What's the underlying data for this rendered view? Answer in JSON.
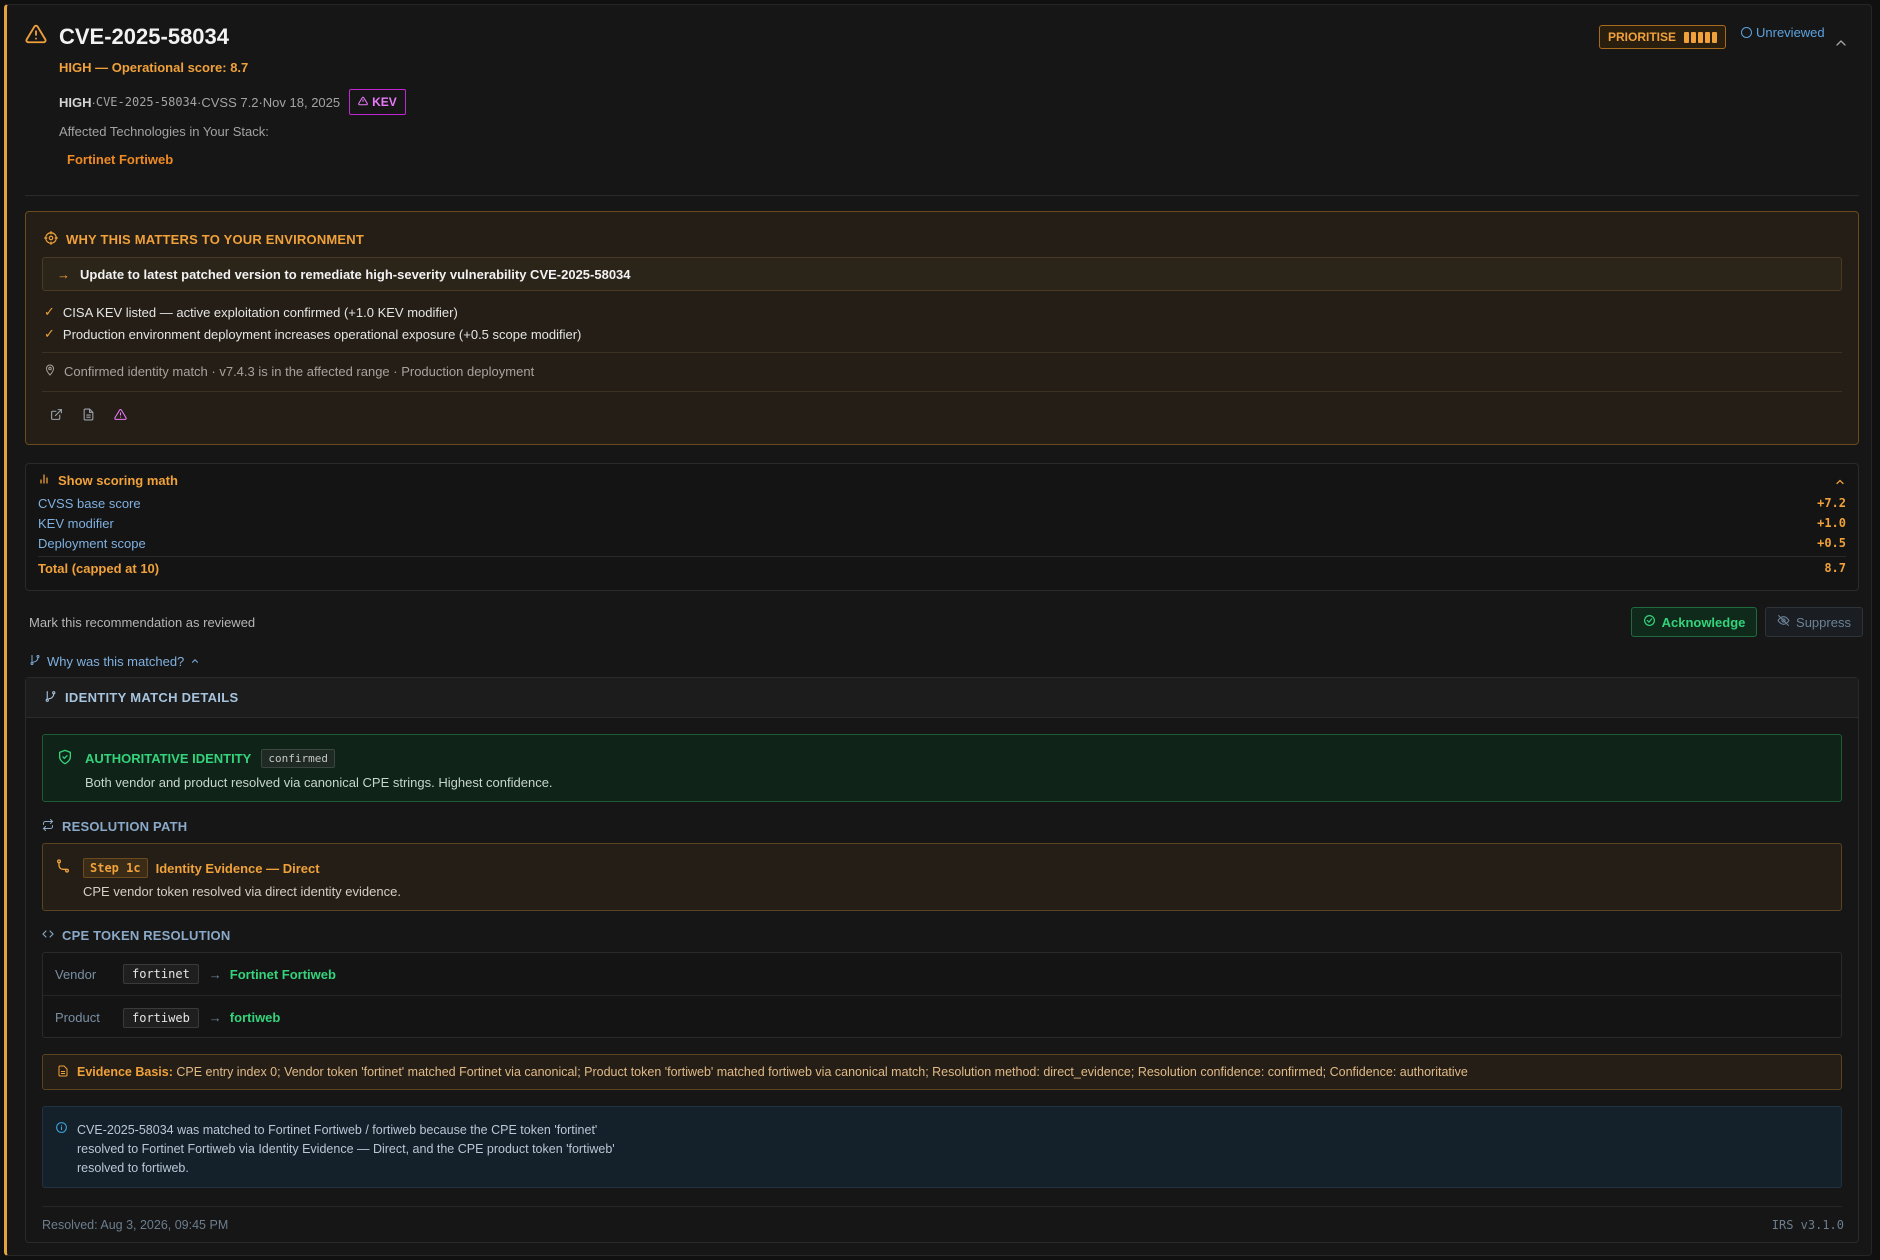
{
  "header": {
    "cve_id": "CVE-2025-58034",
    "severity_line": "HIGH — Operational score: 8.7",
    "meta": {
      "severity": "HIGH",
      "cve_id": "CVE-2025-58034",
      "cvss": "CVSS 7.2",
      "date": "Nov 18, 2025",
      "separator": " · ",
      "kev_label": "KEV"
    },
    "affected_label": "Affected Technologies in Your Stack:",
    "affected_tech": "Fortinet Fortiweb",
    "priority_label": "PRIORITISE",
    "priority_level": 5,
    "review_status": "Unreviewed"
  },
  "why": {
    "title": "WHY THIS MATTERS TO YOUR ENVIRONMENT",
    "recommendation": "Update to latest patched version to remediate high-severity vulnerability CVE-2025-58034",
    "reasons": [
      "CISA KEV listed — active exploitation confirmed (+1.0 KEV modifier)",
      "Production environment deployment increases operational exposure (+0.5 scope modifier)"
    ],
    "identity_line": "Confirmed identity match · v7.4.3 is in the affected range · Production deployment"
  },
  "scoring": {
    "title": "Show scoring math",
    "rows": [
      {
        "label": "CVSS base score",
        "value": "+7.2"
      },
      {
        "label": "KEV modifier",
        "value": "+1.0"
      },
      {
        "label": "Deployment scope",
        "value": "+0.5"
      }
    ],
    "total_label": "Total (capped at 10)",
    "total_value": "8.7"
  },
  "review": {
    "label": "Mark this recommendation as reviewed",
    "acknowledge": "Acknowledge",
    "suppress": "Suppress"
  },
  "matched_toggle": "Why was this matched?",
  "identity": {
    "title": "IDENTITY MATCH DETAILS",
    "auth_title": "AUTHORITATIVE IDENTITY",
    "auth_tag": "confirmed",
    "auth_desc": "Both vendor and product resolved via canonical CPE strings. Highest confidence.",
    "resolution_label": "RESOLUTION PATH",
    "step_tag": "Step 1c",
    "step_title": "Identity Evidence — Direct",
    "step_desc": "CPE vendor token resolved via direct identity evidence.",
    "cpe_label": "CPE TOKEN RESOLUTION",
    "cpe_rows": [
      {
        "key": "Vendor",
        "token": "fortinet",
        "resolved": "Fortinet Fortiweb"
      },
      {
        "key": "Product",
        "token": "fortiweb",
        "resolved": "fortiweb"
      }
    ],
    "evidence_label": "Evidence Basis:",
    "evidence_text": "CPE entry index 0; Vendor token 'fortinet' matched Fortinet via canonical; Product token 'fortiweb' matched fortiweb via canonical match; Resolution method: direct_evidence; Resolution confidence: confirmed; Confidence: authoritative",
    "info_text": "CVE-2025-58034 was matched to Fortinet Fortiweb / fortiweb because the CPE token 'fortinet' resolved to Fortinet Fortiweb via Identity Evidence — Direct, and the CPE product token 'fortiweb' resolved to fortiweb.",
    "resolved": "Resolved: Aug 3, 2026, 09:45 PM",
    "version": "IRS v3.1.0"
  },
  "colors": {
    "accent_orange": "#f0a13a",
    "kev_magenta": "#e879f9",
    "green": "#34d37b",
    "blue": "#5aa3e0"
  }
}
